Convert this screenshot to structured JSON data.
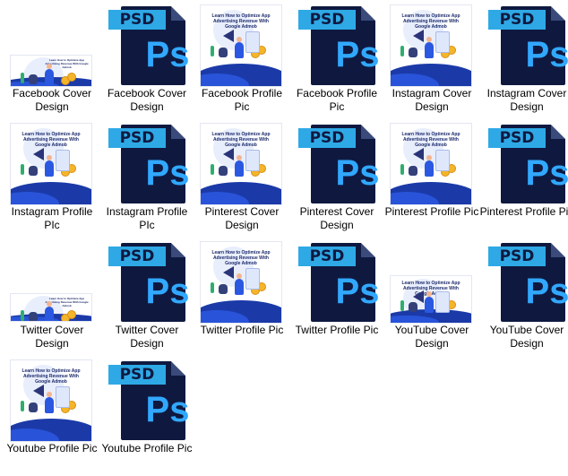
{
  "ps_text": "Ps",
  "psd_text": "PSD",
  "art_title_short": "Learn How to Optimize App Advertising Revenue With Google Admob",
  "items": [
    {
      "label": "Facebook Cover Design",
      "kind": "art",
      "style": "fb-cover"
    },
    {
      "label": "Facebook Cover Design",
      "kind": "psd"
    },
    {
      "label": "Facebook Profile Pic",
      "kind": "art",
      "style": "fb-profile"
    },
    {
      "label": "Facebook Profile Pic",
      "kind": "psd"
    },
    {
      "label": "Instagram Cover Design",
      "kind": "art",
      "style": "ig-cover"
    },
    {
      "label": "Instagram Cover Design",
      "kind": "psd"
    },
    {
      "label": "Instagram Profile PIc",
      "kind": "art",
      "style": "ig-profile"
    },
    {
      "label": "Instagram Profile PIc",
      "kind": "psd"
    },
    {
      "label": "Pinterest Cover Design",
      "kind": "art",
      "style": "pin-cover"
    },
    {
      "label": "Pinterest Cover Design",
      "kind": "psd"
    },
    {
      "label": "Pinterest Profile Pic",
      "kind": "art",
      "style": "pin-profile"
    },
    {
      "label": "Pinterest Profile Pic",
      "kind": "psd"
    },
    {
      "label": "Twitter Cover Design",
      "kind": "art",
      "style": "tw-cover"
    },
    {
      "label": "Twitter Cover Design",
      "kind": "psd"
    },
    {
      "label": "Twitter Profile Pic",
      "kind": "art",
      "style": "tw-profile"
    },
    {
      "label": "Twitter Profile Pic",
      "kind": "psd"
    },
    {
      "label": "YouTube Cover Design",
      "kind": "art",
      "style": "yt-cover"
    },
    {
      "label": "YouTube Cover Design",
      "kind": "psd"
    },
    {
      "label": "Youtube Profile Pic",
      "kind": "art",
      "style": "yt-profile"
    },
    {
      "label": "Youtube Profile Pic",
      "kind": "psd"
    }
  ],
  "colors": {
    "psd_body": "#0f1940",
    "psd_tab": "#2ea9e6",
    "ps_letters": "#31a8ff",
    "art_blue": "#1b3aa8"
  }
}
